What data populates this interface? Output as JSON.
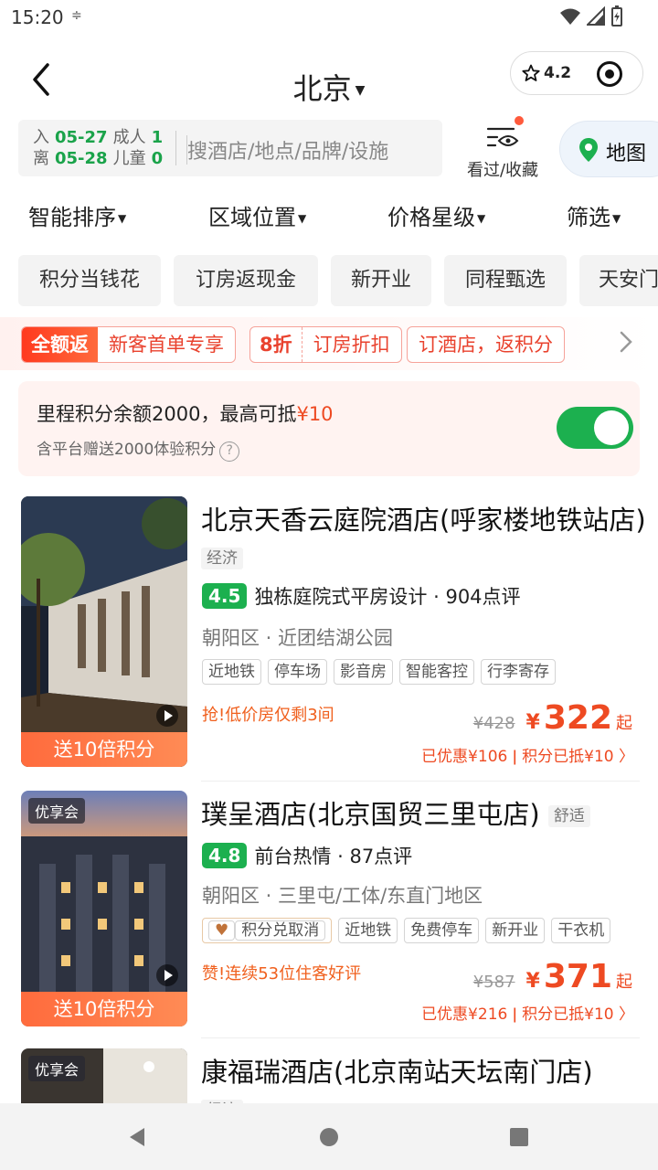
{
  "status": {
    "time": "15:20",
    "sim_icon": "sim-settings-icon"
  },
  "header": {
    "city": "北京",
    "rating": "4.2"
  },
  "search": {
    "checkin_label": "入",
    "checkin_date": "05-27",
    "checkout_label": "离",
    "checkout_date": "05-28",
    "adults_label": "成人",
    "adults": "1",
    "children_label": "儿童",
    "children": "0",
    "placeholder": "搜酒店/地点/品牌/设施"
  },
  "fav_label": "看过/收藏",
  "map_label": "地图",
  "sort": [
    "智能排序",
    "区域位置",
    "价格星级",
    "筛选"
  ],
  "chips": [
    "积分当钱花",
    "订房返现金",
    "新开业",
    "同程甄选",
    "天安门"
  ],
  "promo": {
    "full_return": "全额返",
    "new_user": "新客首单专享",
    "discount": "8折",
    "discount_text": "订房折扣",
    "points_return": "订酒店，返积分"
  },
  "points": {
    "text": "里程积分余额2000，最高可抵",
    "amount": "¥10",
    "sub": "含平台赠送2000体验积分",
    "toggle_on": true
  },
  "hotels": [
    {
      "name": "北京天香云庭院酒店(呼家楼地铁站店)",
      "tier": "经济",
      "score": "4.5",
      "highlight": "独栋庭院式平房设计 · 904点评",
      "location": "朝阳区 · 近团结湖公园",
      "tags": [
        "近地铁",
        "停车场",
        "影音房",
        "智能客控",
        "行李寄存"
      ],
      "urgent": "抢!低价房仅剩3间",
      "old_price": "¥428",
      "currency": "¥",
      "price": "322",
      "suffix": "起",
      "saved": "已优惠¥106 ǀ 积分已抵¥10 〉",
      "badge": "送10倍积分"
    },
    {
      "name": "璞呈酒店(北京国贸三里屯店)",
      "tier": "舒适",
      "vip": "优享会",
      "score": "4.8",
      "highlight": "前台热情 · 87点评",
      "location": "朝阳区 · 三里屯/工体/东直门地区",
      "tags": [
        "积分兑取消",
        "近地铁",
        "免费停车",
        "新开业",
        "干衣机"
      ],
      "urgent": "赞!连续53位住客好评",
      "old_price": "¥587",
      "currency": "¥",
      "price": "371",
      "suffix": "起",
      "saved": "已优惠¥216 ǀ 积分已抵¥10 〉",
      "badge": "送10倍积分"
    },
    {
      "name": "康福瑞酒店(北京南站天坛南门店)",
      "tier": "经济",
      "vip": "优享会"
    }
  ]
}
